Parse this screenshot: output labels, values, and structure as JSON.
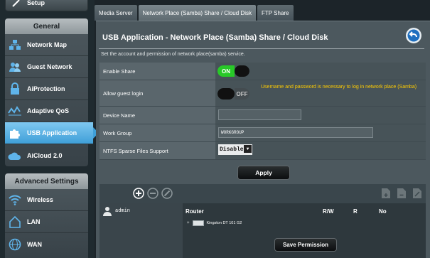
{
  "sidebar": {
    "setup_label": "Setup",
    "general_header": "General",
    "general_items": [
      {
        "label": "Network Map",
        "icon": "network-map-icon"
      },
      {
        "label": "Guest Network",
        "icon": "guest-network-icon"
      },
      {
        "label": "AiProtection",
        "icon": "lock-icon"
      },
      {
        "label": "Adaptive QoS",
        "icon": "qos-icon"
      },
      {
        "label": "USB Application",
        "icon": "puzzle-icon",
        "active": true
      },
      {
        "label": "AiCloud 2.0",
        "icon": "cloud-icon"
      }
    ],
    "advanced_header": "Advanced Settings",
    "advanced_items": [
      {
        "label": "Wireless",
        "icon": "wifi-icon"
      },
      {
        "label": "LAN",
        "icon": "home-icon"
      },
      {
        "label": "WAN",
        "icon": "globe-icon"
      }
    ]
  },
  "tabs": [
    {
      "label": "Media Server"
    },
    {
      "label": "Network Place (Samba) Share / Cloud Disk",
      "active": true
    },
    {
      "label": "FTP Share"
    }
  ],
  "panel": {
    "title": "USB Application - Network Place (Samba) Share / Cloud Disk",
    "description": "Set the account and permission of network place(samba) service."
  },
  "settings": {
    "enable_share": {
      "label": "Enable Share",
      "state": "ON"
    },
    "guest_login": {
      "label": "Allow guest login",
      "state": "OFF",
      "note": "Username and password is necessary to log in network place (Samba)"
    },
    "device_name": {
      "label": "Device Name",
      "value": ""
    },
    "work_group": {
      "label": "Work Group",
      "value": "WORKGROUP"
    },
    "ntfs": {
      "label": "NTFS Sparse Files Support",
      "value": "Disable"
    }
  },
  "apply_label": "Apply",
  "permissions": {
    "user": "admin",
    "headers": {
      "router": "Router",
      "rw": "R/W",
      "r": "R",
      "no": "No"
    },
    "disk": "Kingston DT 101 G2",
    "save_label": "Save Permission"
  },
  "colors": {
    "accent": "#3f9fd8",
    "on_green": "#28c928",
    "warning": "#ffcc00"
  }
}
